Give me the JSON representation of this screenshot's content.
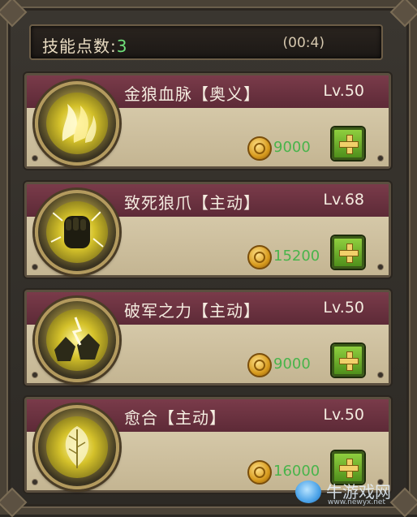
{
  "header": {
    "label": "技能点数:",
    "points": "3",
    "timer": "(00:4)"
  },
  "skills": [
    {
      "name": "金狼血脉【奥义】",
      "level": "Lv.50",
      "cost": "9000",
      "icon": "golden-wolf-bloodline-icon"
    },
    {
      "name": "致死狼爪【主动】",
      "level": "Lv.68",
      "cost": "15200",
      "icon": "deadly-wolf-claw-icon"
    },
    {
      "name": "破军之力【主动】",
      "level": "Lv.50",
      "cost": "9000",
      "icon": "army-breaking-power-icon"
    },
    {
      "name": "愈合【主动】",
      "level": "Lv.50",
      "cost": "16000",
      "icon": "healing-icon"
    }
  ],
  "watermark": {
    "text": "牛游戏网",
    "url": "www.newyx.net"
  },
  "colors": {
    "title_band": "#6b3240",
    "panel": "#cbbd9d",
    "cost_green": "#49b44b",
    "points_green": "#6fe07a",
    "plus_button": "#6aa82b"
  }
}
